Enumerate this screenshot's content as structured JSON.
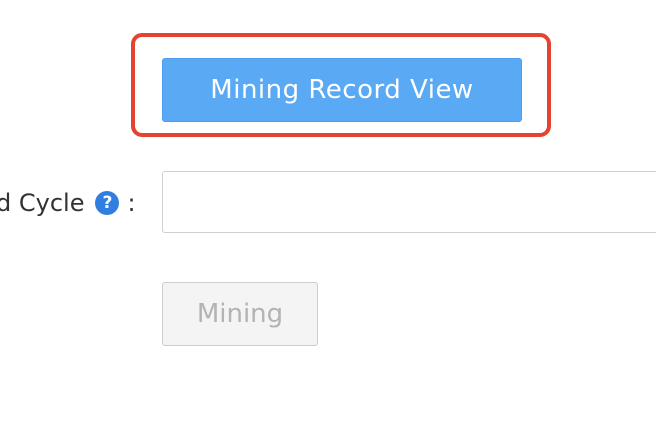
{
  "record_button": {
    "label": "Mining Record View",
    "highlight_color": "#e5432f",
    "color": "#5aa9f5"
  },
  "form": {
    "field_label": "d Cycle",
    "help_icon": "question-circle-icon",
    "help_glyph": "?",
    "colon": ":",
    "input_value": ""
  },
  "mining_button": {
    "label": "Mining",
    "disabled": true
  }
}
